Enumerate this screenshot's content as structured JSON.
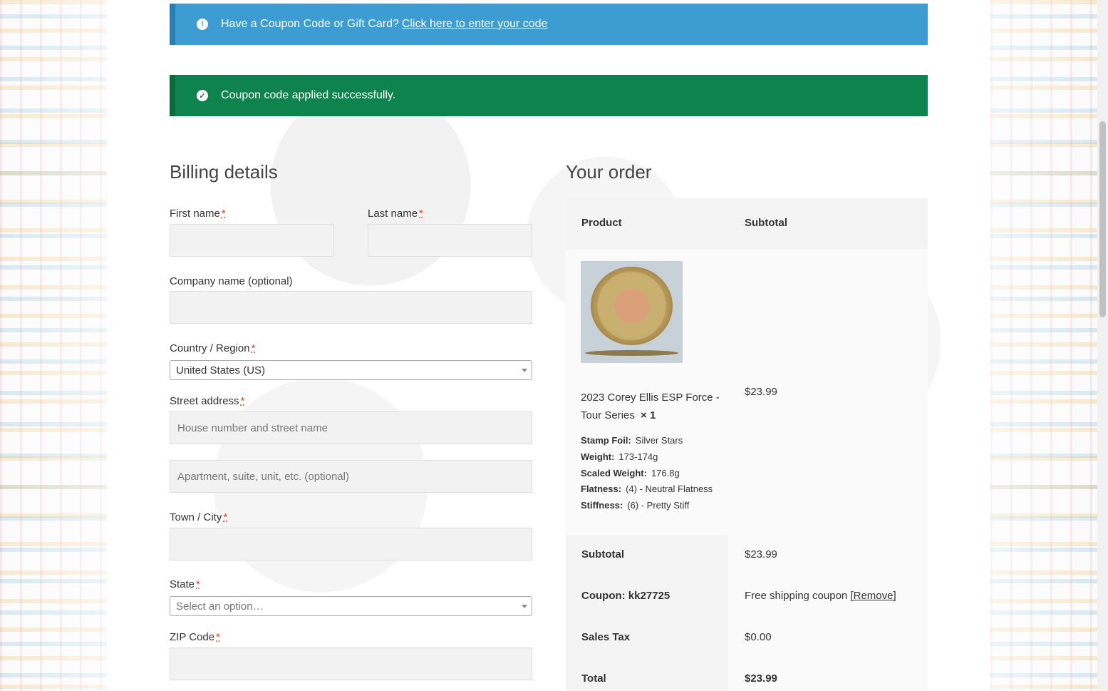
{
  "notices": {
    "coupon_prompt": "Have a Coupon Code or Gift Card?",
    "coupon_link": "Click here to enter your code",
    "success": "Coupon code applied successfully."
  },
  "billing": {
    "heading": "Billing details",
    "first_name_label": "First name",
    "last_name_label": "Last name",
    "company_label": "Company name (optional)",
    "country_label": "Country / Region",
    "country_value": "United States (US)",
    "street_label": "Street address",
    "street_placeholder": "House number and street name",
    "apartment_placeholder": "Apartment, suite, unit, etc. (optional)",
    "city_label": "Town / City",
    "state_label": "State",
    "state_placeholder": "Select an option…",
    "zip_label": "ZIP Code",
    "required_mark": "*"
  },
  "order": {
    "heading": "Your order",
    "col_product": "Product",
    "col_subtotal": "Subtotal",
    "item": {
      "name_line1": "2023 Corey Ellis ESP Force -",
      "name_line2": "Tour Series",
      "qty": "× 1",
      "price": "$23.99",
      "meta": [
        {
          "key": "Stamp Foil:",
          "value": "Silver Stars"
        },
        {
          "key": "Weight:",
          "value": "173-174g"
        },
        {
          "key": "Scaled Weight:",
          "value": "176.8g"
        },
        {
          "key": "Flatness:",
          "value": "(4) - Neutral Flatness"
        },
        {
          "key": "Stiffness:",
          "value": "(6) - Pretty Stiff"
        }
      ]
    },
    "subtotal_label": "Subtotal",
    "subtotal_value": "$23.99",
    "coupon_label": "Coupon: kk27725",
    "coupon_value": "Free shipping coupon",
    "coupon_remove": "[Remove]",
    "tax_label": "Sales Tax",
    "tax_value": "$0.00",
    "total_label": "Total",
    "total_value": "$23.99"
  },
  "colors": {
    "info": "#3d9cd2",
    "success": "#0f834d",
    "required": "#e2401c"
  }
}
